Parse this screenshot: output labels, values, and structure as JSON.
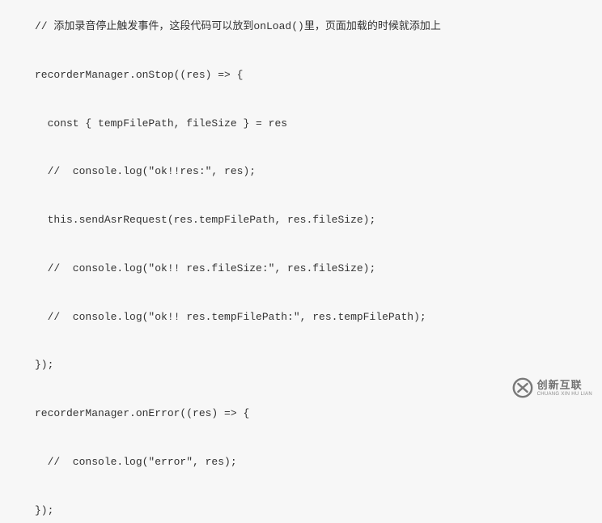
{
  "code": {
    "lines": [
      "// 添加录音停止触发事件，这段代码可以放到onLoad()里，页面加载的时候就添加上",
      "",
      "recorderManager.onStop((res) => {",
      "",
      "  const { tempFilePath, fileSize } = res",
      "",
      "  //  console.log(\"ok!!res:\", res);",
      "",
      "  this.sendAsrRequest(res.tempFilePath, res.fileSize);",
      "",
      "  //  console.log(\"ok!! res.fileSize:\", res.fileSize);",
      "",
      "  //  console.log(\"ok!! res.tempFilePath:\", res.tempFilePath);",
      "",
      "});",
      "",
      "recorderManager.onError((res) => {",
      "",
      "  //  console.log(\"error\", res);",
      "",
      "});"
    ]
  },
  "watermark": {
    "cn": "创新互联",
    "en": "CHUANG XIN HU LIAN"
  }
}
